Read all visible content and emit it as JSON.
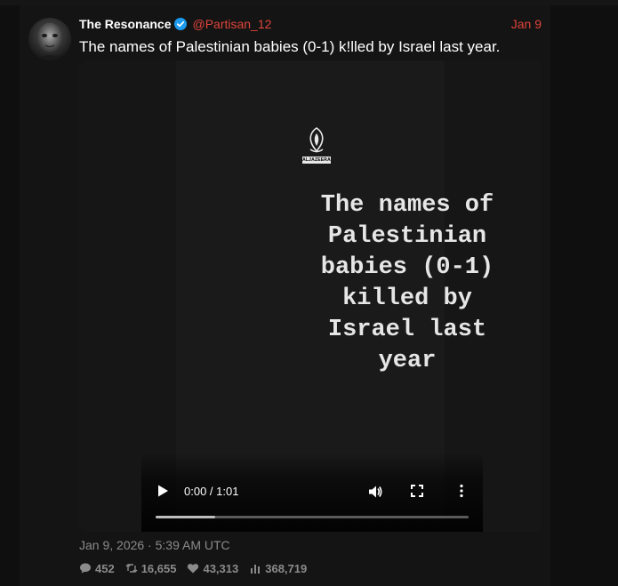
{
  "tweet": {
    "display_name": "The Resonance",
    "handle": "@Partisan_12",
    "date": "Jan 9",
    "text": "The names of Palestinian babies (0-1) k!lled by Israel last year.",
    "timestamp": "Jan 9, 2026 · 5:39 AM UTC",
    "accent_color": "#e0443a",
    "verified_color": "#1d9bf0"
  },
  "media": {
    "logo_text": "ALJAZEERA",
    "caption_lines": [
      "The names of",
      "Palestinian",
      "babies (0-1)",
      "killed by",
      "Israel last",
      "year"
    ],
    "player": {
      "time": "0:00 / 1:01",
      "progress_fraction": 0.19,
      "icons": [
        "play-icon",
        "volume-icon",
        "fullscreen-icon",
        "more-vertical-icon"
      ]
    }
  },
  "stats": {
    "replies": "452",
    "retweets": "16,655",
    "likes": "43,313",
    "views": "368,719",
    "icons": [
      "comment-icon",
      "retweet-icon",
      "heart-icon",
      "views-icon"
    ]
  }
}
